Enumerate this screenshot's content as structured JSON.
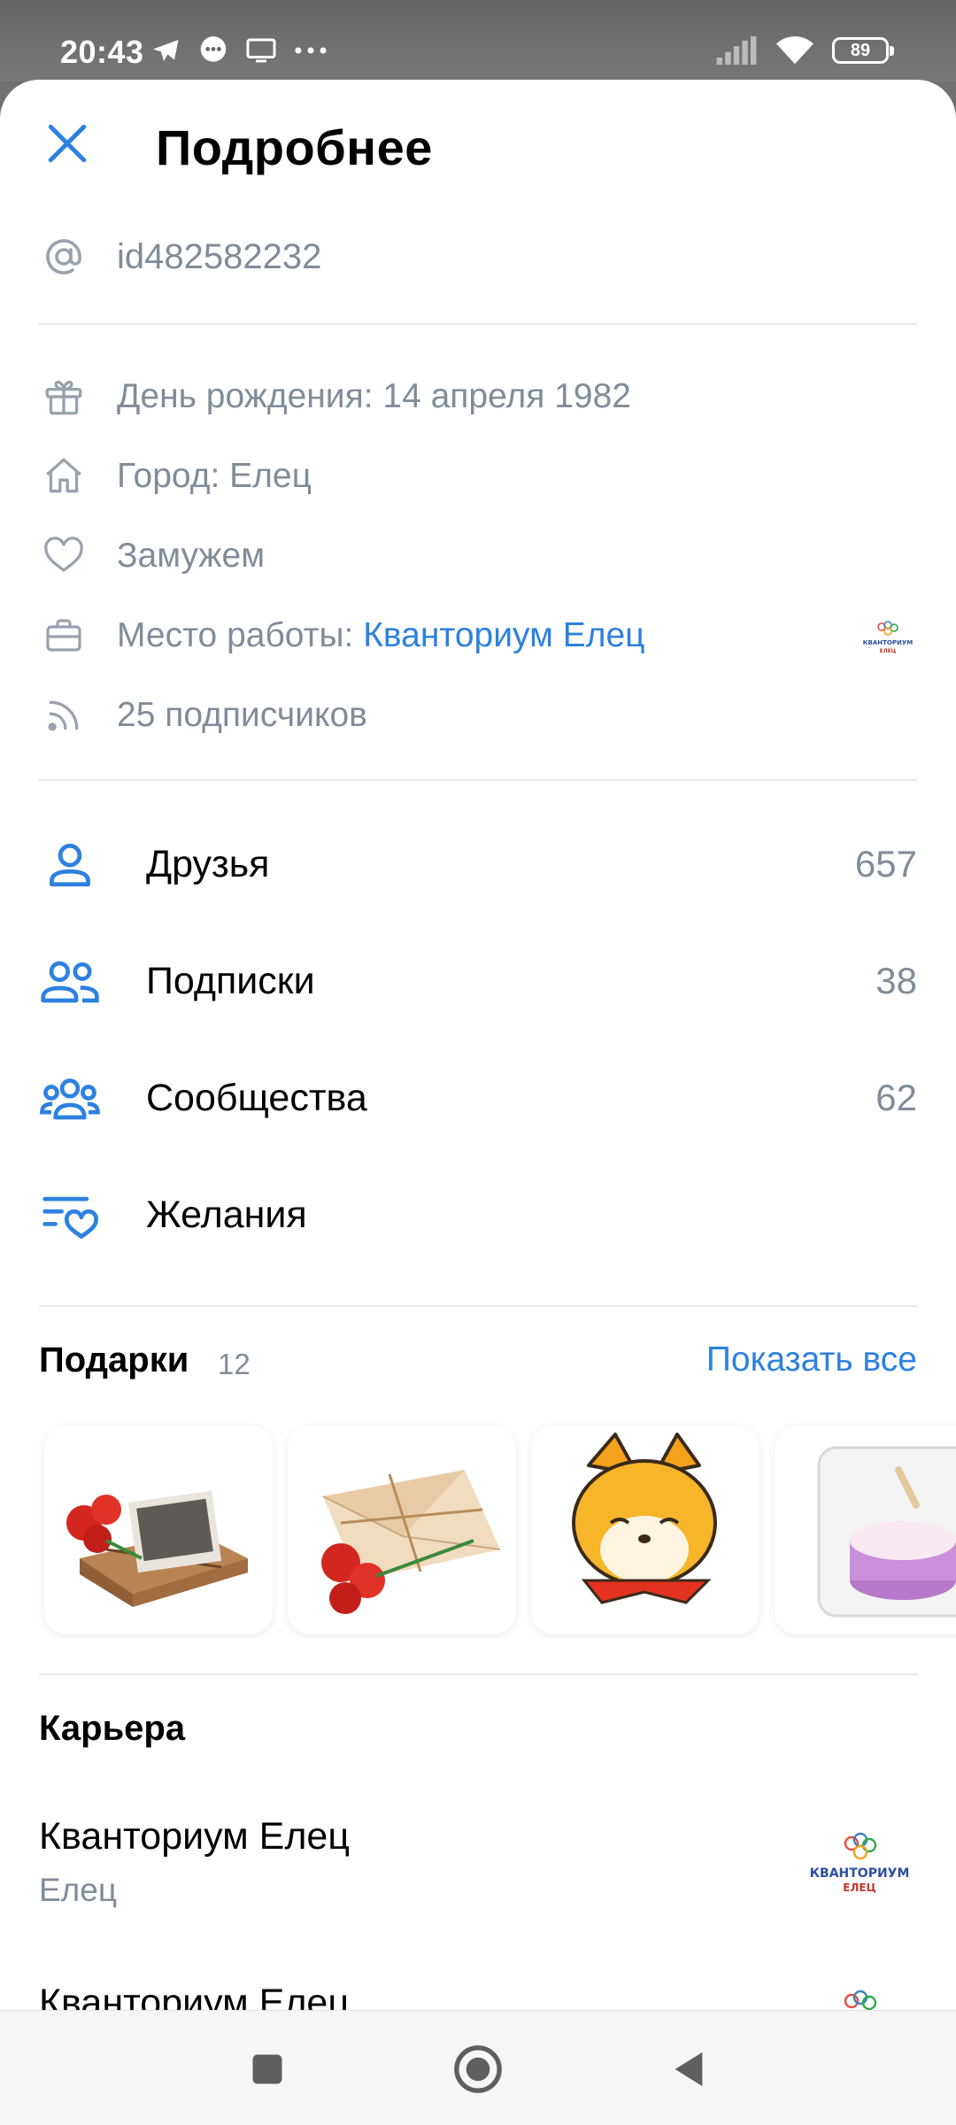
{
  "status": {
    "time": "20:43",
    "battery": "89"
  },
  "header": {
    "title": "Подробнее"
  },
  "profile": {
    "username": "id482582232",
    "birthday": "День рождения: 14 апреля 1982",
    "city": "Город: Елец",
    "relationship": "Замужем",
    "work_prefix": "Место работы: ",
    "work_link": "Кванториум Елец",
    "followers": "25 подписчиков"
  },
  "menu": [
    {
      "label": "Друзья",
      "count": "657",
      "icon": "person-icon"
    },
    {
      "label": "Подписки",
      "count": "38",
      "icon": "people-icon"
    },
    {
      "label": "Сообщества",
      "count": "62",
      "icon": "communities-icon"
    },
    {
      "label": "Желания",
      "count": "",
      "icon": "wishlist-icon"
    }
  ],
  "gifts": {
    "title": "Подарки",
    "count": "12",
    "show_all": "Показать все",
    "items": [
      "parcel-carnations-gift",
      "envelope-carnations-gift",
      "shiba-dog-gift",
      "cake-box-gift"
    ]
  },
  "career": {
    "title": "Карьера",
    "items": [
      {
        "name": "Кванториум Елец",
        "city": "Елец"
      },
      {
        "name": "Кванториум Елец",
        "city": ""
      }
    ],
    "logo_text_1": "КВАНТОРИУМ",
    "logo_text_2": "ЕЛЕЦ"
  },
  "colors": {
    "accent": "#2d81e0",
    "secondary_text": "#818c99",
    "divider": "#e7e8ec"
  }
}
